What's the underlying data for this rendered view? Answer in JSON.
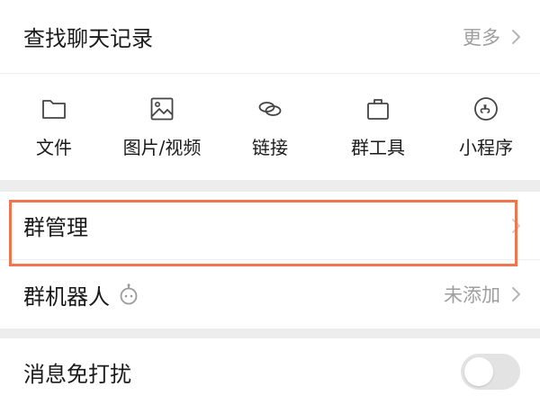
{
  "search_history": {
    "title": "查找聊天记录",
    "more_label": "更多",
    "chevron_icon": "chevron-right-icon"
  },
  "tools": [
    {
      "label": "文件",
      "icon": "folder-icon"
    },
    {
      "label": "图片/视频",
      "icon": "image-icon"
    },
    {
      "label": "链接",
      "icon": "link-icon"
    },
    {
      "label": "群工具",
      "icon": "briefcase-icon"
    },
    {
      "label": "小程序",
      "icon": "mini-program-icon"
    }
  ],
  "group_management": {
    "title": "群管理",
    "chevron_icon": "chevron-right-icon",
    "highlighted": true,
    "highlight_color": "#f0754e"
  },
  "group_robot": {
    "title": "群机器人",
    "icon": "robot-icon",
    "status": "未添加",
    "chevron_icon": "chevron-right-icon"
  },
  "do_not_disturb": {
    "title": "消息免打扰",
    "toggle_on": false
  },
  "colors": {
    "background": "#ededed",
    "card": "#ffffff",
    "text": "#1a1a1a",
    "muted": "#9e9e9e",
    "highlight": "#f0754e",
    "toggle_off": "#e3e3e3"
  }
}
